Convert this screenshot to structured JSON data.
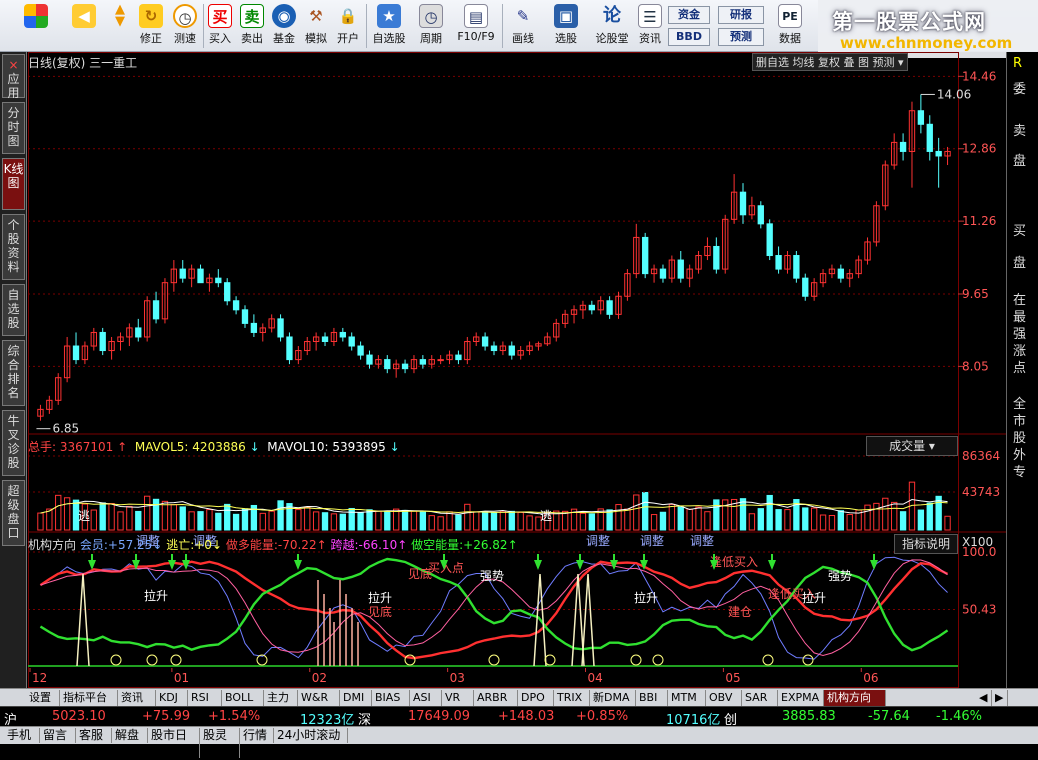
{
  "toolbar": {
    "buttons": [
      {
        "label": "",
        "icon": "grid-icon"
      },
      {
        "label": "",
        "icon": "back-arrow-icon"
      },
      {
        "label": "修正",
        "icon": "refresh-icon"
      },
      {
        "label": "测速",
        "icon": "clock-icon"
      },
      {
        "label": "买入",
        "icon": "buy-icon"
      },
      {
        "label": "卖出",
        "icon": "sell-icon"
      },
      {
        "label": "基金",
        "icon": "fund-icon"
      },
      {
        "label": "模拟",
        "icon": "gavel-icon"
      },
      {
        "label": "开户",
        "icon": "lock-icon"
      },
      {
        "label": "自选股",
        "icon": "star-icon"
      },
      {
        "label": "周期",
        "icon": "period-icon"
      },
      {
        "label": "F10/F9",
        "icon": "f10-icon"
      },
      {
        "label": "画线",
        "icon": "pen-icon"
      },
      {
        "label": "选股",
        "icon": "screen-icon"
      },
      {
        "label": "论股堂",
        "icon": "talk-icon"
      },
      {
        "label": "资讯",
        "icon": "news-icon"
      },
      {
        "label": "数据",
        "icon": "pe-icon"
      }
    ],
    "zijin": "资金",
    "bbd": "BBD",
    "yanbao": "研报",
    "yuce": "预测",
    "pe": "PE"
  },
  "brand": {
    "title": "第一股票公式网",
    "url": "www.chnmoney.com"
  },
  "left_tabs": [
    "应用",
    "分时图",
    "K线图",
    "个股资料",
    "自选股",
    "综合排名",
    "牛叉诊股",
    "超级盘口"
  ],
  "main_title": "日线(复权)  三一重工",
  "top_right_buttons": [
    "删自选",
    "均线",
    "复权",
    "叠",
    "图",
    "预测"
  ],
  "price_axis": [
    "14.46",
    "12.86",
    "11.26",
    "9.65",
    "8.05"
  ],
  "price_annotations": {
    "high": "14.06",
    "low": "6.85"
  },
  "volume": {
    "label": "总手:",
    "total": "3367101",
    "mavol5_label": "MAVOL5:",
    "mavol5": "4203886",
    "mavol10_label": "MAVOL10:",
    "mavol10": "5393895",
    "dropdown": "成交量",
    "axis": [
      "86364",
      "43743",
      "X100"
    ]
  },
  "indicator": {
    "name": "机构方向",
    "huiyuan_label": "会员:",
    "huiyuan": "+57.25",
    "taowang_label": "逃亡:",
    "taowang": "+0",
    "zuoduo_label": "做多能量:",
    "zuoduo": "-70.22",
    "kuayue_label": "跨越:",
    "kuayue": "-66.10",
    "zuokong_label": "做空能量:",
    "zuokong": "+26.82",
    "help": "指标说明",
    "axis": [
      "100.0",
      "50.43"
    ],
    "labels": [
      "逃",
      "调整",
      "调整",
      "拉升",
      "见底",
      "买入点",
      "强势",
      "逃",
      "调整",
      "调整",
      "调整",
      "逢低买入",
      "逢低买入",
      "强势",
      "拉升",
      "拉升",
      "拉升",
      "建仓",
      "见底"
    ]
  },
  "months": [
    "12",
    "01",
    "02",
    "03",
    "04",
    "05",
    "06"
  ],
  "bottom_tabs": [
    "设置",
    "指标平台",
    "资讯",
    "KDJ",
    "RSI",
    "BOLL",
    "主力",
    "W&R",
    "DMI",
    "BIAS",
    "ASI",
    "VR",
    "ARBR",
    "DPO",
    "TRIX",
    "新DMA",
    "BBI",
    "MTM",
    "OBV",
    "SAR",
    "EXPMA",
    "机构方向"
  ],
  "status": {
    "sh_label": "沪",
    "sh_index": "5023.10",
    "sh_change": "+75.99",
    "sh_pct": "+1.54%",
    "sh_amount": "12323亿",
    "sz_label": "深",
    "sz_index": "17649.09",
    "sz_change": "+148.03",
    "sz_pct": "+0.85%",
    "sz_amount": "10716亿",
    "cy_label": "创",
    "cy_index": "3885.83",
    "cy_change": "-57.64",
    "cy_pct": "-1.46%"
  },
  "status_links": [
    "手机",
    "留言",
    "客服",
    "解盘",
    "股市日记",
    "股灵通",
    "行情",
    "24小时滚动"
  ],
  "right_side": [
    "委",
    "卖",
    "盘",
    "买",
    "盘",
    "在最强涨点",
    "全市股外专"
  ],
  "colors": {
    "up": "#ff3232",
    "down": "#54ffff",
    "bg": "#000000",
    "grid": "#7a0000"
  },
  "chart_data": {
    "type": "candlestick",
    "title": "日线(复权)  三一重工",
    "ylim": [
      6.6,
      14.6
    ],
    "candles": [
      [
        6.95,
        7.2,
        6.85,
        7.1
      ],
      [
        7.1,
        7.4,
        7.0,
        7.3
      ],
      [
        7.3,
        7.9,
        7.2,
        7.8
      ],
      [
        7.8,
        8.7,
        7.7,
        8.5
      ],
      [
        8.5,
        8.8,
        8.1,
        8.2
      ],
      [
        8.2,
        8.6,
        8.1,
        8.5
      ],
      [
        8.5,
        8.9,
        8.4,
        8.8
      ],
      [
        8.8,
        8.9,
        8.3,
        8.4
      ],
      [
        8.4,
        8.7,
        8.2,
        8.6
      ],
      [
        8.6,
        8.8,
        8.4,
        8.7
      ],
      [
        8.7,
        9.0,
        8.5,
        8.9
      ],
      [
        8.9,
        9.1,
        8.6,
        8.7
      ],
      [
        8.7,
        9.6,
        8.6,
        9.5
      ],
      [
        9.5,
        9.7,
        9.0,
        9.1
      ],
      [
        9.1,
        10.0,
        9.0,
        9.9
      ],
      [
        9.9,
        10.4,
        9.7,
        10.2
      ],
      [
        10.2,
        10.4,
        9.9,
        10.0
      ],
      [
        10.0,
        10.3,
        9.8,
        10.2
      ],
      [
        10.2,
        10.3,
        9.9,
        9.9
      ],
      [
        9.9,
        10.1,
        9.7,
        10.0
      ],
      [
        10.0,
        10.2,
        9.8,
        9.9
      ],
      [
        9.9,
        10.0,
        9.4,
        9.5
      ],
      [
        9.5,
        9.6,
        9.2,
        9.3
      ],
      [
        9.3,
        9.4,
        8.9,
        9.0
      ],
      [
        9.0,
        9.2,
        8.7,
        8.8
      ],
      [
        8.8,
        9.0,
        8.6,
        8.9
      ],
      [
        8.9,
        9.2,
        8.8,
        9.1
      ],
      [
        9.1,
        9.2,
        8.6,
        8.7
      ],
      [
        8.7,
        8.8,
        8.1,
        8.2
      ],
      [
        8.2,
        8.5,
        8.1,
        8.4
      ],
      [
        8.4,
        8.7,
        8.3,
        8.6
      ],
      [
        8.6,
        8.8,
        8.4,
        8.7
      ],
      [
        8.7,
        8.8,
        8.5,
        8.6
      ],
      [
        8.6,
        8.9,
        8.5,
        8.8
      ],
      [
        8.8,
        8.9,
        8.6,
        8.7
      ],
      [
        8.7,
        8.8,
        8.4,
        8.5
      ],
      [
        8.5,
        8.6,
        8.2,
        8.3
      ],
      [
        8.3,
        8.4,
        8.0,
        8.1
      ],
      [
        8.1,
        8.3,
        8.0,
        8.2
      ],
      [
        8.2,
        8.3,
        7.9,
        8.0
      ],
      [
        8.0,
        8.2,
        7.8,
        8.1
      ],
      [
        8.1,
        8.2,
        7.9,
        8.0
      ],
      [
        8.0,
        8.3,
        7.9,
        8.2
      ],
      [
        8.2,
        8.3,
        8.0,
        8.1
      ],
      [
        8.1,
        8.3,
        8.0,
        8.2
      ],
      [
        8.2,
        8.3,
        8.1,
        8.2
      ],
      [
        8.2,
        8.4,
        8.1,
        8.3
      ],
      [
        8.3,
        8.4,
        8.1,
        8.2
      ],
      [
        8.2,
        8.7,
        8.1,
        8.6
      ],
      [
        8.6,
        8.8,
        8.5,
        8.7
      ],
      [
        8.7,
        8.8,
        8.4,
        8.5
      ],
      [
        8.5,
        8.6,
        8.3,
        8.4
      ],
      [
        8.4,
        8.6,
        8.3,
        8.5
      ],
      [
        8.5,
        8.6,
        8.2,
        8.3
      ],
      [
        8.3,
        8.5,
        8.2,
        8.4
      ],
      [
        8.4,
        8.6,
        8.3,
        8.5
      ],
      [
        8.5,
        8.6,
        8.4,
        8.55
      ],
      [
        8.55,
        8.8,
        8.5,
        8.7
      ],
      [
        8.7,
        9.1,
        8.6,
        9.0
      ],
      [
        9.0,
        9.3,
        8.9,
        9.2
      ],
      [
        9.2,
        9.4,
        9.0,
        9.3
      ],
      [
        9.3,
        9.5,
        9.1,
        9.4
      ],
      [
        9.4,
        9.5,
        9.2,
        9.3
      ],
      [
        9.3,
        9.6,
        9.2,
        9.5
      ],
      [
        9.5,
        9.6,
        9.1,
        9.2
      ],
      [
        9.2,
        9.7,
        9.1,
        9.6
      ],
      [
        9.6,
        10.2,
        9.5,
        10.1
      ],
      [
        10.1,
        11.2,
        10.0,
        10.9
      ],
      [
        10.9,
        11.0,
        10.0,
        10.1
      ],
      [
        10.1,
        10.3,
        9.9,
        10.2
      ],
      [
        10.2,
        10.3,
        9.9,
        10.0
      ],
      [
        10.0,
        10.5,
        9.9,
        10.4
      ],
      [
        10.4,
        10.6,
        9.9,
        10.0
      ],
      [
        10.0,
        10.3,
        9.8,
        10.2
      ],
      [
        10.2,
        10.6,
        10.1,
        10.5
      ],
      [
        10.5,
        10.9,
        10.4,
        10.7
      ],
      [
        10.7,
        10.9,
        10.1,
        10.2
      ],
      [
        10.2,
        11.4,
        10.1,
        11.3
      ],
      [
        11.3,
        12.3,
        11.2,
        11.9
      ],
      [
        11.9,
        12.1,
        11.2,
        11.4
      ],
      [
        11.4,
        11.8,
        11.3,
        11.6
      ],
      [
        11.6,
        11.7,
        11.1,
        11.2
      ],
      [
        11.2,
        11.3,
        10.4,
        10.5
      ],
      [
        10.5,
        10.7,
        10.1,
        10.2
      ],
      [
        10.2,
        10.6,
        10.1,
        10.5
      ],
      [
        10.5,
        10.6,
        9.9,
        10.0
      ],
      [
        10.0,
        10.1,
        9.5,
        9.6
      ],
      [
        9.6,
        10.0,
        9.5,
        9.9
      ],
      [
        9.9,
        10.2,
        9.8,
        10.1
      ],
      [
        10.1,
        10.3,
        10.0,
        10.2
      ],
      [
        10.2,
        10.3,
        9.9,
        10.0
      ],
      [
        10.0,
        10.2,
        9.8,
        10.1
      ],
      [
        10.1,
        10.5,
        10.0,
        10.4
      ],
      [
        10.4,
        10.9,
        10.3,
        10.8
      ],
      [
        10.8,
        11.7,
        10.7,
        11.6
      ],
      [
        11.6,
        12.6,
        11.5,
        12.5
      ],
      [
        12.5,
        13.2,
        12.4,
        13.0
      ],
      [
        13.0,
        13.2,
        12.6,
        12.8
      ],
      [
        12.8,
        13.9,
        12.0,
        13.7
      ],
      [
        13.7,
        14.06,
        13.2,
        13.4
      ],
      [
        13.4,
        13.6,
        12.6,
        12.8
      ],
      [
        12.8,
        13.1,
        12.0,
        12.7
      ],
      [
        12.7,
        12.9,
        12.5,
        12.8
      ]
    ],
    "volume_axis": [
      0,
      86364
    ],
    "indicator_axis": [
      0,
      100
    ]
  }
}
